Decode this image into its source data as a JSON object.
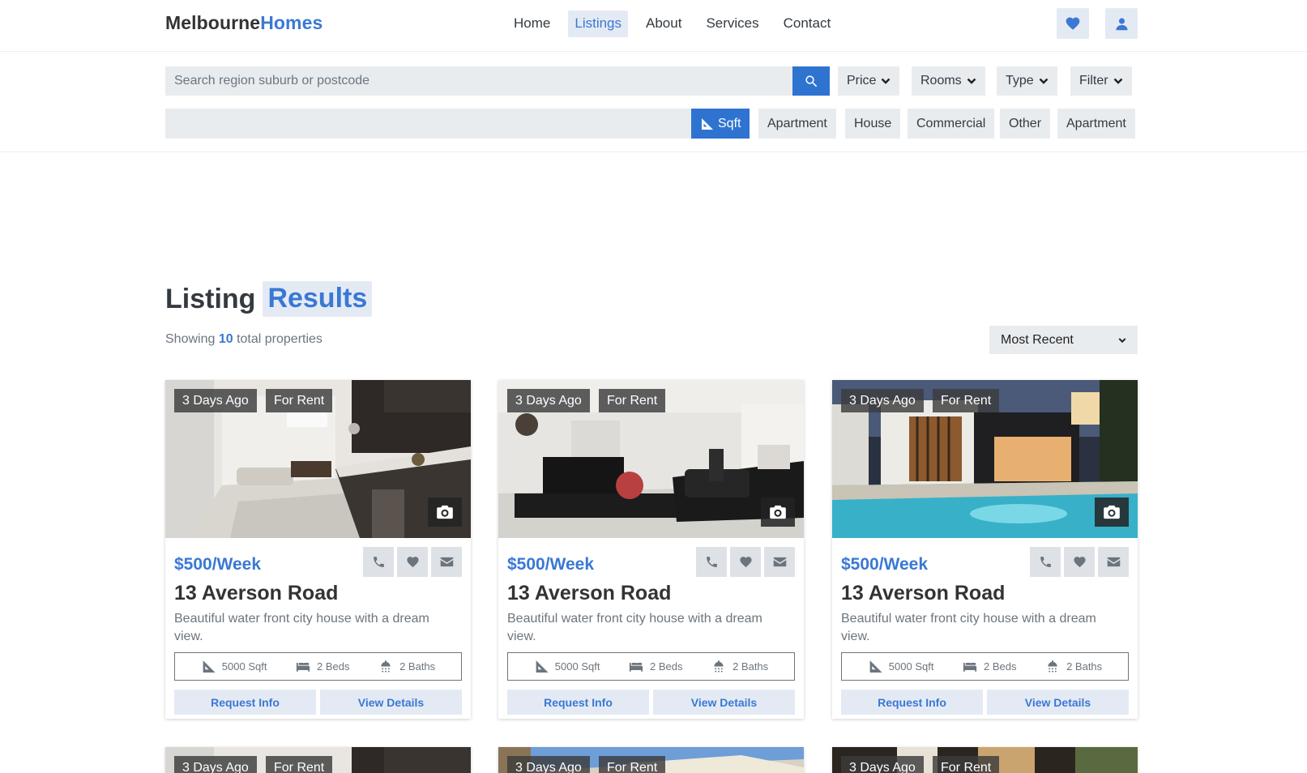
{
  "header": {
    "brand_part1": "Melbourne",
    "brand_part2": "Homes",
    "nav": [
      {
        "label": "Home"
      },
      {
        "label": "Listings"
      },
      {
        "label": "About"
      },
      {
        "label": "Services"
      },
      {
        "label": "Contact"
      }
    ],
    "active_nav": "Listings",
    "favorites_icon": "heart-icon",
    "account_icon": "user-icon"
  },
  "search": {
    "placeholder": "Search region suburb or postcode",
    "value": "",
    "dropdowns": [
      "Price",
      "Rooms",
      "Type",
      "Filter"
    ],
    "chips": [
      "Sqft",
      "Apartment",
      "House",
      "Commercial",
      "Other",
      "Apartment"
    ],
    "active_chip": "Sqft"
  },
  "results": {
    "title_part1": "Listing",
    "title_part2": "Results",
    "showing_prefix": "Showing",
    "count": "10",
    "showing_suffix": "total properties",
    "sort_selected": "Most Recent"
  },
  "listings": [
    {
      "age": "3 Days Ago",
      "status": "For Rent",
      "price": "$500/Week",
      "address": "13 Averson Road",
      "description": "Beautiful water front city house with a dream view.",
      "area": "5000 Sqft",
      "beds": "2 Beds",
      "baths": "2 Baths",
      "request": "Request Info",
      "details": "View Details"
    },
    {
      "age": "3 Days Ago",
      "status": "For Rent",
      "price": "$500/Week",
      "address": "13 Averson Road",
      "description": "Beautiful water front city house with a dream view.",
      "area": "5000 Sqft",
      "beds": "2 Beds",
      "baths": "2 Baths",
      "request": "Request Info",
      "details": "View Details"
    },
    {
      "age": "3 Days Ago",
      "status": "For Rent",
      "price": "$500/Week",
      "address": "13 Averson Road",
      "description": "Beautiful water front city house with a dream view.",
      "area": "5000 Sqft",
      "beds": "2 Beds",
      "baths": "2 Baths",
      "request": "Request Info",
      "details": "View Details"
    }
  ],
  "next_row": [
    {
      "age": "3 Days Ago",
      "status": "For Rent"
    },
    {
      "age": "3 Days Ago",
      "status": "For Rent"
    },
    {
      "age": "3 Days Ago",
      "status": "For Rent"
    }
  ],
  "colors": {
    "accent": "#3a78d4",
    "primary_button": "#2f73d1",
    "chip_bg": "#e9ecef",
    "highlight_bg": "#e4eaf4"
  }
}
